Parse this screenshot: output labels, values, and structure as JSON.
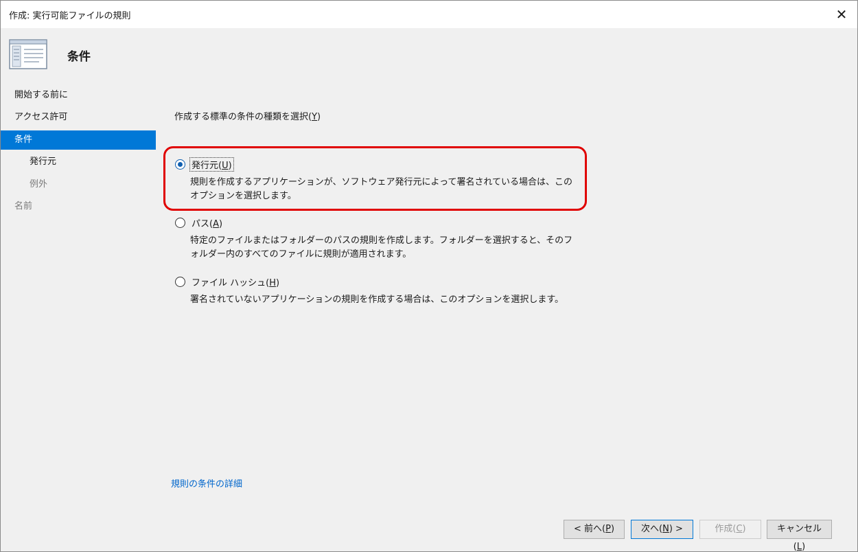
{
  "window": {
    "title": "作成: 実行可能ファイルの規則",
    "close_glyph": "✕"
  },
  "header": {
    "title": "条件",
    "icon": "wizard-page-icon"
  },
  "sidebar": {
    "items": [
      {
        "label": "開始する前に",
        "state": "normal"
      },
      {
        "label": "アクセス許可",
        "state": "normal"
      },
      {
        "label": "条件",
        "state": "active"
      },
      {
        "label": "発行元",
        "state": "sub"
      },
      {
        "label": "例外",
        "state": "sub-disabled"
      },
      {
        "label": "名前",
        "state": "disabled"
      }
    ]
  },
  "main": {
    "prompt_text": "作成する標準の条件の種類を選択(",
    "prompt_key": "Y",
    "prompt_end": ")",
    "options": [
      {
        "label_text": "発行元(",
        "label_key": "U",
        "label_end": ")",
        "description": "規則を作成するアプリケーションが、ソフトウェア発行元によって署名されている場合は、このオプションを選択します。",
        "checked": true
      },
      {
        "label_text": "パス(",
        "label_key": "A",
        "label_end": ")",
        "description": "特定のファイルまたはフォルダーのパスの規則を作成します。フォルダーを選択すると、そのフォルダー内のすべてのファイルに規則が適用されます。",
        "checked": false
      },
      {
        "label_text": "ファイル ハッシュ(",
        "label_key": "H",
        "label_end": ")",
        "description": "署名されていないアプリケーションの規則を作成する場合は、このオプションを選択します。",
        "checked": false
      }
    ],
    "details_link": "規則の条件の詳細"
  },
  "footer": {
    "back": {
      "text": "< 前へ(",
      "key": "P",
      "end": ")"
    },
    "next": {
      "text": "次へ(",
      "key": "N",
      "end": ") >"
    },
    "create": {
      "text": "作成(",
      "key": "C",
      "end": ")"
    },
    "cancel": {
      "text": "キャンセル(",
      "key": "L",
      "end": ")"
    }
  },
  "colors": {
    "accent": "#0078d7",
    "highlight_box": "#e00000",
    "link": "#0066cc"
  }
}
